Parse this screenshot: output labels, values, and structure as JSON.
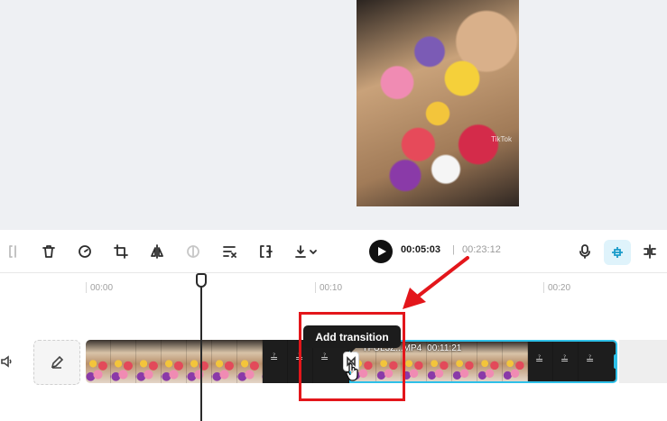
{
  "preview": {
    "watermark": "TikTok"
  },
  "toolbar": {
    "icons": [
      "split-left-icon",
      "delete-icon",
      "speed-icon",
      "crop-icon",
      "flip-icon",
      "opacity-icon",
      "remove-background-icon",
      "freeze-frame-icon",
      "download-icon"
    ],
    "time_current": "00:05:03",
    "time_separator": "|",
    "time_total": "00:23:12"
  },
  "ruler": {
    "labels": [
      "00:00",
      "00:10",
      "00:20"
    ]
  },
  "timeline": {
    "clip_b_name": "YFUL3Z...MP4",
    "clip_b_duration": "00:11:21"
  },
  "tooltip": {
    "text": "Add transition"
  },
  "colors": {
    "accent": "#2ec0e8",
    "annotation": "#e3161b",
    "tooltip_bg": "#1c1c1c"
  }
}
